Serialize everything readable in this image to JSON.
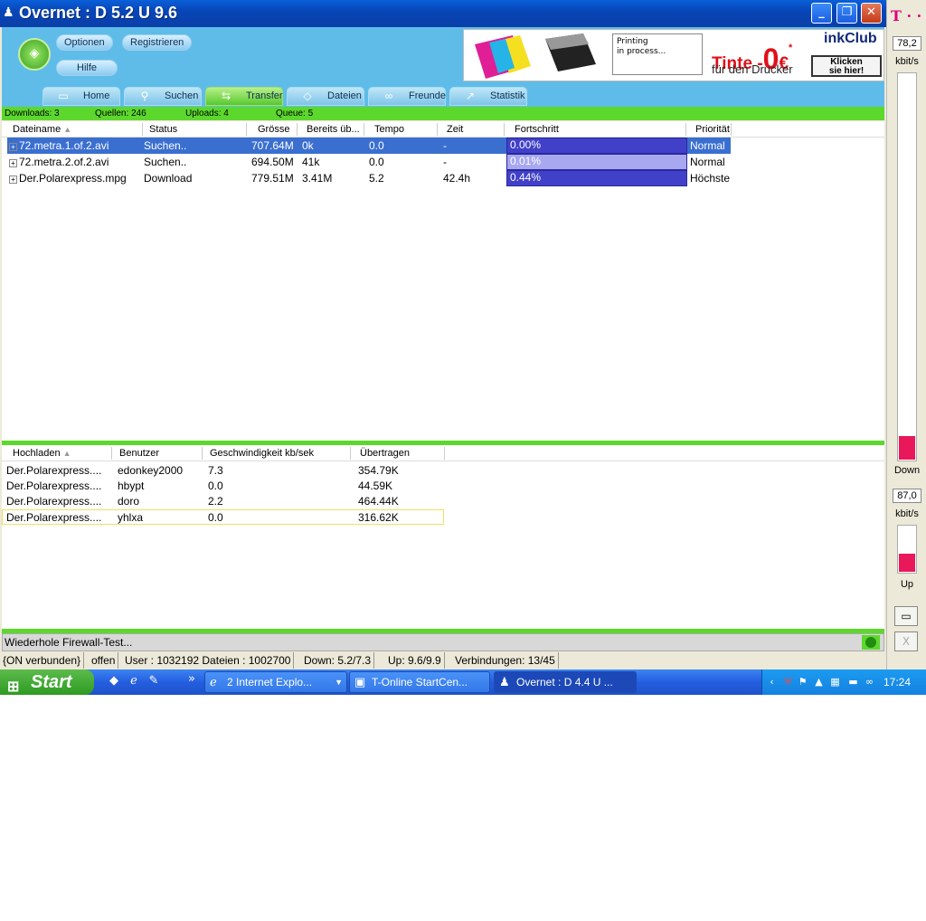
{
  "window": {
    "title": "Overnet : D 5.2 U 9.6",
    "controls": {
      "minimize": "_",
      "restore": "❐",
      "close": "✕"
    }
  },
  "toolbar": {
    "options_label": "Optionen",
    "register_label": "Registrieren",
    "help_label": "Hilfe"
  },
  "ad": {
    "printing_line1": "Printing",
    "printing_line2": "in process...",
    "tinte": "Tinte -",
    "zero": "0",
    "currency": "€",
    "asterisk": "*",
    "drucker": "für den Drucker",
    "brand": "inkClub",
    "click_line1": "Klicken",
    "click_line2": "sie hier!"
  },
  "tabs": [
    {
      "label": "Home",
      "icon": "home-icon"
    },
    {
      "label": "Suchen",
      "icon": "search-icon"
    },
    {
      "label": "Transfer",
      "icon": "transfer-icon"
    },
    {
      "label": "Dateien",
      "icon": "files-icon"
    },
    {
      "label": "Freunde",
      "icon": "friends-icon"
    },
    {
      "label": "Statistik",
      "icon": "statistics-icon"
    }
  ],
  "summary": {
    "downloads": "Downloads: 3",
    "sources": "Quellen: 246",
    "uploads": "Uploads: 4",
    "queue": "Queue: 5"
  },
  "downloads": {
    "columns": [
      "Dateiname",
      "Status",
      "Grösse",
      "Bereits üb...",
      "Tempo",
      "Zeit",
      "Fortschritt",
      "Priorität"
    ],
    "rows": [
      {
        "name": "72.metra.1.of.2.avi",
        "status": "Suchen..",
        "size": "707.64M",
        "done": "0k",
        "speed": "0.0",
        "time": "-",
        "progress": "0.00%",
        "progress_fraction": 0.0,
        "priority": "Normal",
        "selected": true
      },
      {
        "name": "72.metra.2.of.2.avi",
        "status": "Suchen..",
        "size": "694.50M",
        "done": "41k",
        "speed": "0.0",
        "time": "-",
        "progress": "0.01%",
        "progress_fraction": 0.0001,
        "priority": "Normal",
        "selected": false
      },
      {
        "name": "Der.Polarexpress.mpg",
        "status": "Download",
        "size": "779.51M",
        "done": "3.41M",
        "speed": "5.2",
        "time": "42.4h",
        "progress": "0.44%",
        "progress_fraction": 0.0044,
        "priority": "Höchste",
        "selected": false
      }
    ]
  },
  "uploads": {
    "columns": [
      "Hochladen",
      "Benutzer",
      "Geschwindigkeit kb/sek",
      "Übertragen"
    ],
    "rows": [
      {
        "file": "Der.Polarexpress....",
        "user": "edonkey2000",
        "speed": "7.3",
        "transferred": "354.79K"
      },
      {
        "file": "Der.Polarexpress....",
        "user": "hbypt",
        "speed": "0.0",
        "transferred": "44.59K"
      },
      {
        "file": "Der.Polarexpress....",
        "user": "doro",
        "speed": "2.2",
        "transferred": "464.44K"
      },
      {
        "file": "Der.Polarexpress....",
        "user": "yhlxa",
        "speed": "0.0",
        "transferred": "316.62K"
      }
    ]
  },
  "firewall_status": "Wiederhole Firewall-Test...",
  "statusbar": {
    "connection": "{ON verbunden}",
    "port": "offen",
    "users": "User : 1032192 Dateien : 1002700",
    "down": "Down: 5.2/7.3",
    "up": "Up: 9.6/9.9",
    "connections": "Verbindungen: 13/45"
  },
  "meter": {
    "brand_glyph": "T · ·",
    "down_value": "78,2",
    "up_value": "87,0",
    "unit": "kbit/s",
    "down_label": "Down",
    "up_label": "Up",
    "down_level": 0.06,
    "up_level": 0.4,
    "window_btn": "▭",
    "close_btn": "X"
  },
  "taskbar": {
    "start_label": "Start",
    "chevron": "»",
    "tasks": [
      {
        "label": "2 Internet Explo...",
        "icon": "ie-icon",
        "has_dropdown": true
      },
      {
        "label": "T-Online StartCen...",
        "icon": "t-online-icon"
      },
      {
        "label": "Overnet : D 4.4 U ...",
        "icon": "overnet-icon",
        "active": true
      }
    ],
    "clock": "17:24"
  }
}
